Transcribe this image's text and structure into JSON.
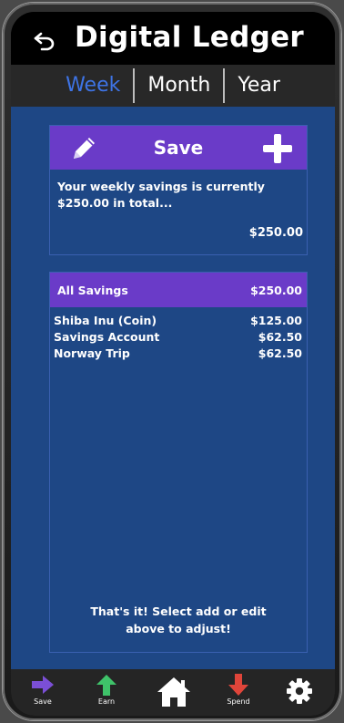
{
  "app": {
    "title": "Digital Ledger"
  },
  "tabs": [
    {
      "label": "Week",
      "active": true
    },
    {
      "label": "Month",
      "active": false
    },
    {
      "label": "Year",
      "active": false
    }
  ],
  "save_card": {
    "title": "Save",
    "message": "Your weekly savings is currently $250.00 in total...",
    "total": "$250.00"
  },
  "savings_card": {
    "header_label": "All Savings",
    "header_total": "$250.00",
    "items": [
      {
        "name": "Shiba Inu (Coin)",
        "amount": "$125.00"
      },
      {
        "name": "Savings Account",
        "amount": "$62.50"
      },
      {
        "name": "Norway Trip",
        "amount": "$62.50"
      }
    ],
    "footer_line1": "That's it! Select add or edit",
    "footer_line2": "above to adjust!"
  },
  "bottom_nav": [
    {
      "label": "Save",
      "icon": "arrow-right-icon",
      "color": "#7b4fd6"
    },
    {
      "label": "Earn",
      "icon": "arrow-up-icon",
      "color": "#3fc36a"
    },
    {
      "label": "",
      "icon": "home-icon",
      "color": "#ffffff"
    },
    {
      "label": "Spend",
      "icon": "arrow-down-icon",
      "color": "#e0453a"
    },
    {
      "label": "",
      "icon": "gear-icon",
      "color": "#ffffff"
    }
  ],
  "colors": {
    "accent_purple": "#6a3bc8",
    "content_blue": "#1e4785",
    "active_tab": "#3e74e6"
  }
}
